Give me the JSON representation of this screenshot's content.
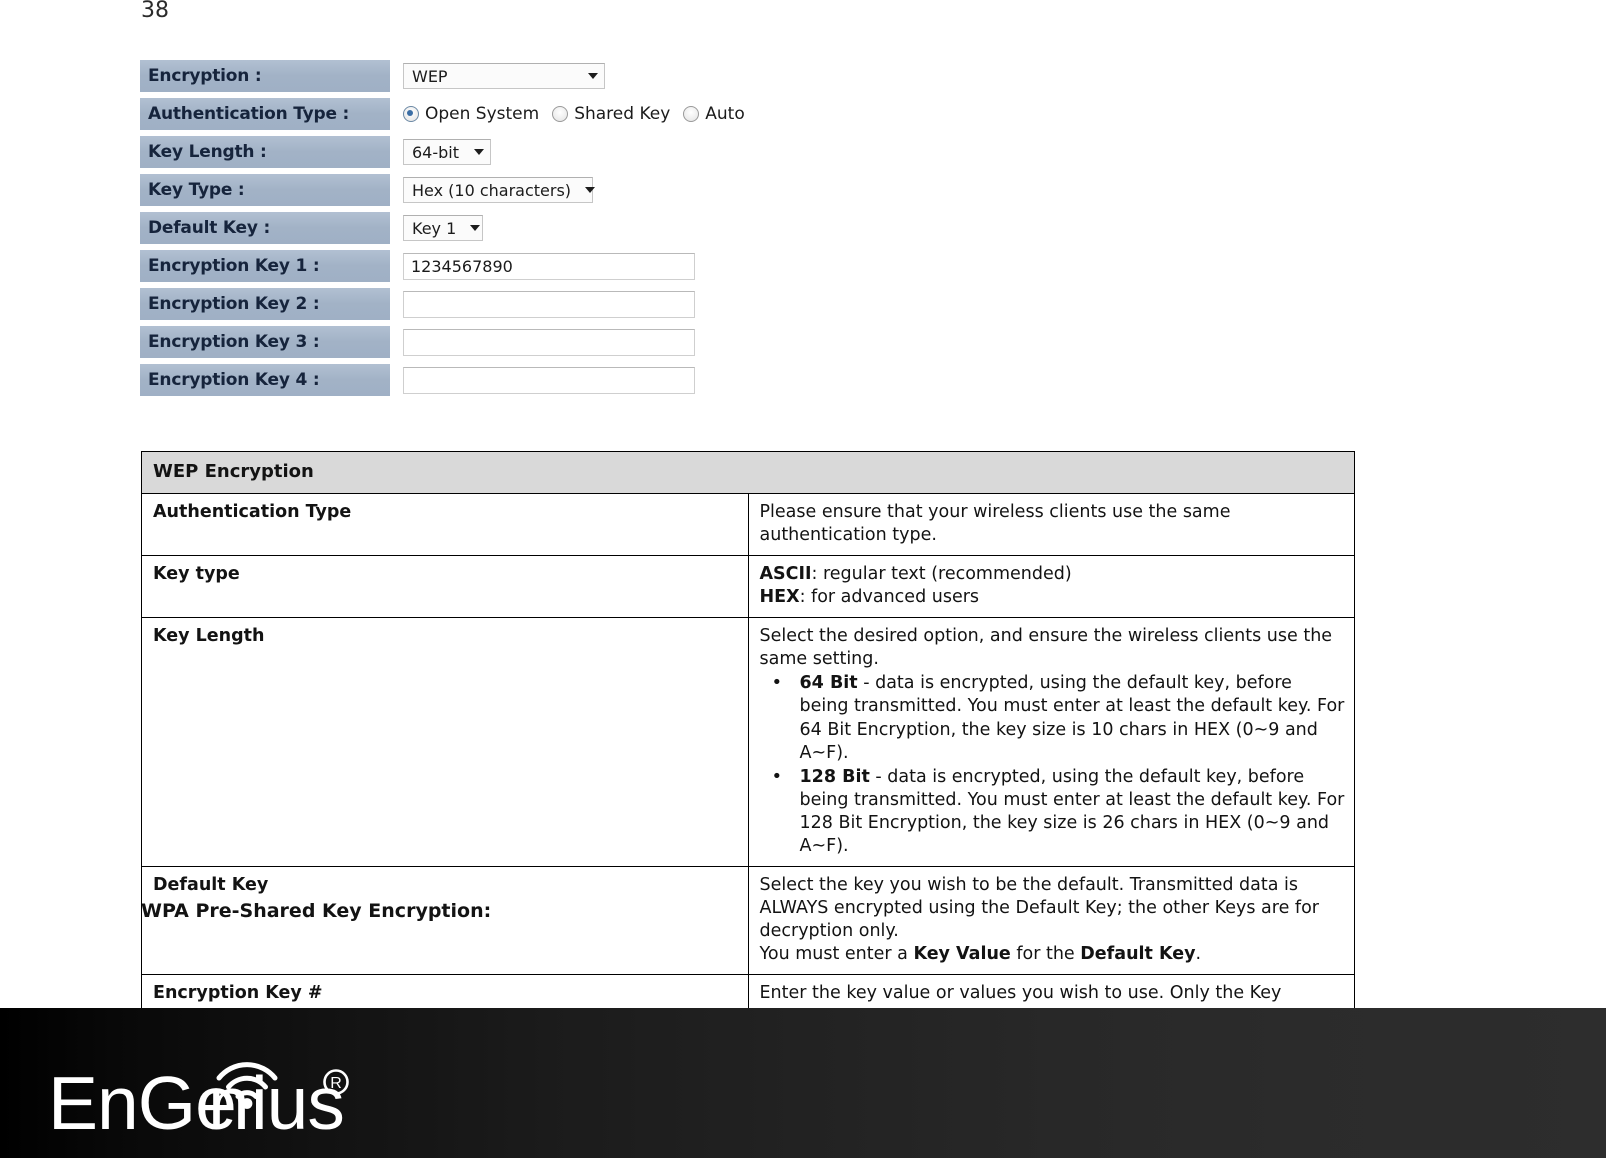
{
  "page": {
    "number": "38"
  },
  "config_form": {
    "rows": [
      {
        "label": "Encryption :",
        "control": "select",
        "value": "WEP"
      },
      {
        "label": "Authentication Type :",
        "control": "radio"
      },
      {
        "label": "Key Length :",
        "control": "select",
        "value": "64-bit"
      },
      {
        "label": "Key Type :",
        "control": "select",
        "value": "Hex (10 characters)"
      },
      {
        "label": "Default Key :",
        "control": "select",
        "value": "Key 1"
      },
      {
        "label": "Encryption Key 1 :",
        "control": "text",
        "value": "1234567890"
      },
      {
        "label": "Encryption Key 2 :",
        "control": "text",
        "value": ""
      },
      {
        "label": "Encryption Key 3 :",
        "control": "text",
        "value": ""
      },
      {
        "label": "Encryption Key 4 :",
        "control": "text",
        "value": ""
      }
    ],
    "auth_options": [
      {
        "label": "Open System",
        "selected": true
      },
      {
        "label": "Shared Key",
        "selected": false
      },
      {
        "label": "Auto",
        "selected": false
      }
    ]
  },
  "desc_table": {
    "header": "WEP Encryption",
    "rows": {
      "auth_type": {
        "key": "Authentication Type",
        "text": "Please ensure that your wireless clients use the same authentication type."
      },
      "key_type": {
        "key": "Key type",
        "ascii_label": "ASCII",
        "ascii_text": ": regular text (recommended)",
        "hex_label": "HEX",
        "hex_text": ": for advanced users"
      },
      "key_length": {
        "key": "Key Length",
        "intro": "Select the desired option, and ensure the wireless clients use the same setting.",
        "bullet1_label": "64 Bit",
        "bullet1_text": " - data is encrypted, using the default key, before being transmitted. You must enter at least the default key. For 64 Bit Encryption, the key size is 10 chars in HEX (0~9 and A~F).",
        "bullet2_label": "128 Bit",
        "bullet2_text": " - data is encrypted, using the default key, before being transmitted. You must enter at least the default key. For 128 Bit Encryption, the key size is 26 chars in HEX (0~9 and A~F)."
      },
      "default_key": {
        "key": "Default Key",
        "line1": "Select the key you wish to be the default. Transmitted data is ALWAYS encrypted using the Default Key; the other Keys are for decryption only.",
        "line2_pre": "You must enter a ",
        "line2_b1": "Key Value",
        "line2_mid": " for the ",
        "line2_b2": "Default Key",
        "line2_post": "."
      },
      "encryption_key": {
        "key": "Encryption Key #",
        "text": "Enter the key value or values you wish to use. Only the Key selected as Default is required. The others are optional."
      }
    }
  },
  "caption": "WPA Pre-Shared Key Encryption:",
  "footer": {
    "brand": "EnGenius",
    "registered_mark": "®",
    "background": "#111111"
  }
}
